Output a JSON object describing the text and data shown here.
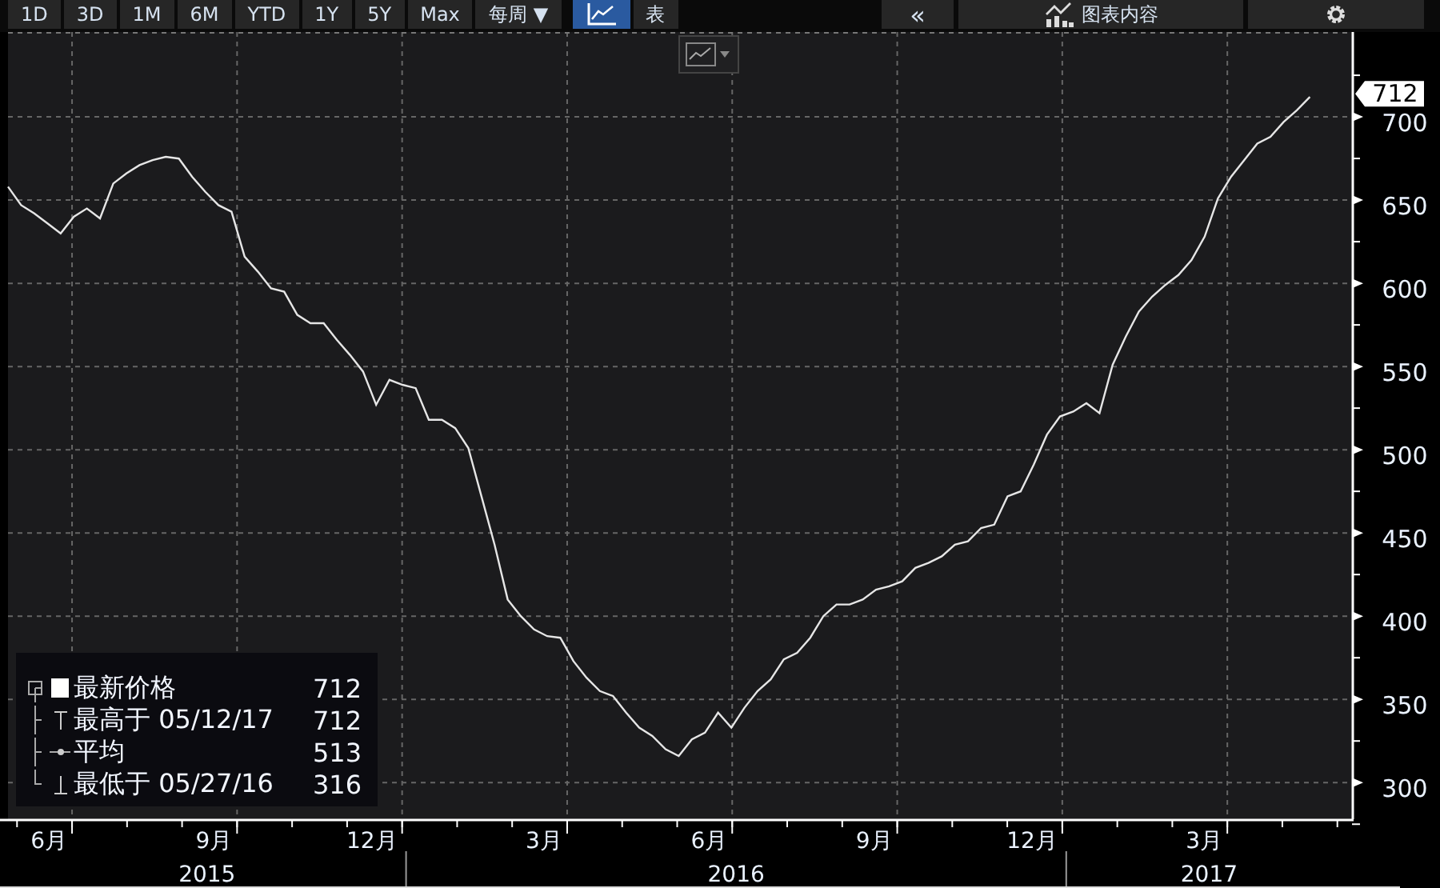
{
  "toolbar": {
    "ranges": [
      "1D",
      "3D",
      "1M",
      "6M",
      "YTD",
      "1Y",
      "5Y",
      "Max"
    ],
    "frequency": {
      "label": "每周",
      "caret": "▼"
    },
    "views": [
      {
        "kind": "chart",
        "selected": true
      },
      {
        "kind": "table",
        "label": "表",
        "selected": false
      }
    ],
    "collapse": "«",
    "chart_contents": "图表内容"
  },
  "chart": {
    "last_value_tag": "712",
    "chart_data": {
      "type": "line",
      "series": [
        {
          "name": "最新价格",
          "color": "#e6e6e6",
          "values": [
            658,
            647,
            642,
            636,
            630,
            640,
            645,
            639,
            660,
            666,
            671,
            674,
            676,
            675,
            664,
            655,
            647,
            643,
            616,
            607,
            597,
            595,
            581,
            576,
            576,
            566,
            557,
            547,
            527,
            542,
            539,
            537,
            518,
            518,
            513,
            501,
            472,
            443,
            410,
            400,
            392,
            388,
            387,
            373,
            363,
            355,
            352,
            342,
            333,
            328,
            320,
            316,
            326,
            330,
            342,
            333,
            345,
            355,
            362,
            374,
            378,
            387,
            400,
            407,
            407,
            410,
            416,
            418,
            421,
            429,
            432,
            436,
            443,
            445,
            453,
            455,
            472,
            475,
            491,
            509,
            520,
            523,
            528,
            522,
            551,
            568,
            583,
            592,
            599,
            605,
            614,
            628,
            651,
            664,
            674,
            684,
            688,
            697,
            704,
            712
          ]
        }
      ],
      "ylim": [
        278,
        751
      ],
      "grid": true,
      "yticks": [
        300,
        350,
        400,
        450,
        500,
        550,
        600,
        650,
        700
      ]
    },
    "x_axis": [
      {
        "year": "2015",
        "months": [
          "6月",
          "9月",
          "12月"
        ]
      },
      {
        "year": "2016",
        "months": [
          "3月",
          "6月",
          "9月",
          "12月"
        ]
      },
      {
        "year": "2017",
        "months": [
          "3月"
        ]
      }
    ],
    "legend": [
      {
        "kind": "last",
        "value": "712"
      },
      {
        "kind": "high",
        "label": "最高于 05/12/17",
        "value": "712"
      },
      {
        "kind": "average",
        "label": "平均",
        "value": "513"
      },
      {
        "kind": "low",
        "label": "最低于 05/27/16",
        "value": "316"
      }
    ]
  }
}
